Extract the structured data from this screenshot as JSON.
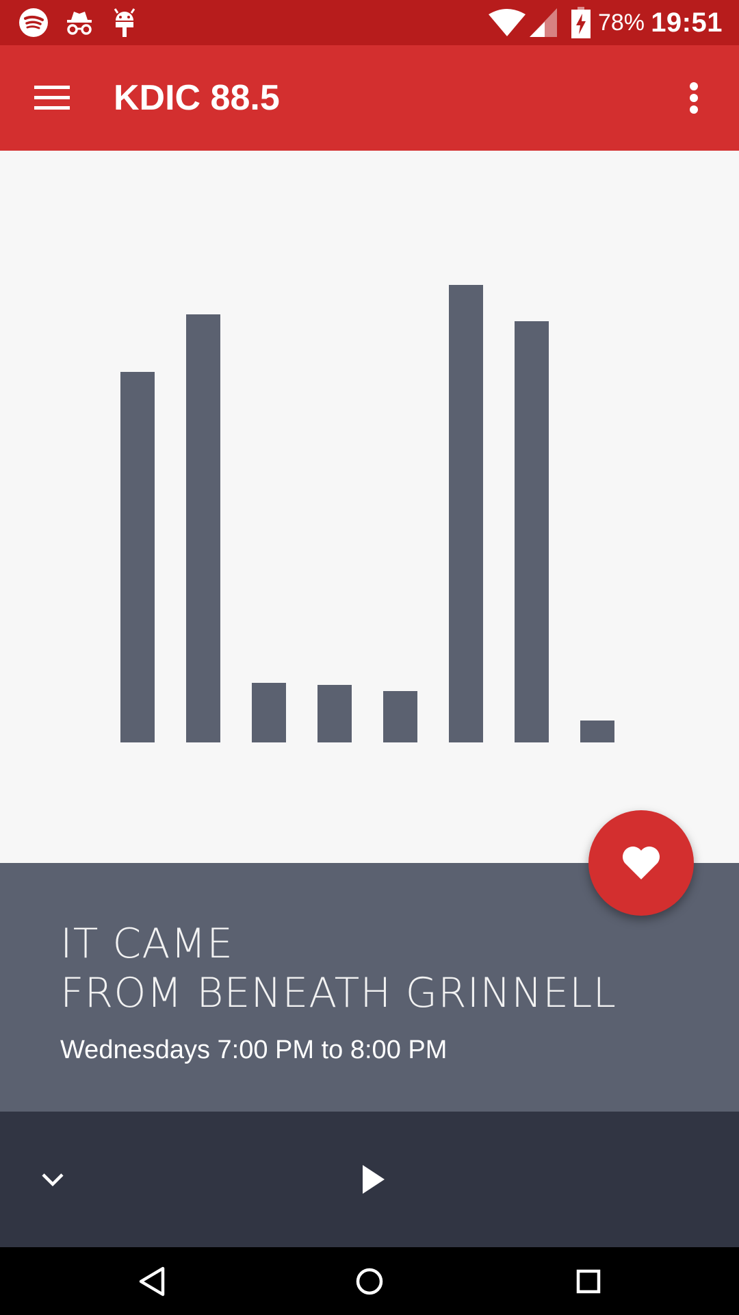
{
  "status_bar": {
    "notification_icons": [
      "spotify-icon",
      "incognito-icon",
      "android-debug-icon"
    ],
    "wifi_icon": "wifi-icon",
    "signal_icon": "cell-signal-icon",
    "battery_icon": "battery-charging-icon",
    "battery_percent": "78%",
    "time": "19:51"
  },
  "app_bar": {
    "menu_icon": "hamburger-menu-icon",
    "title": "KDIC 88.5",
    "overflow_icon": "more-vert-icon"
  },
  "visualizer": {
    "color": "#5b6170",
    "levels": [
      0.81,
      0.935,
      0.13,
      0.125,
      0.112,
      1.0,
      0.92,
      0.048
    ]
  },
  "favorite_button": {
    "icon": "heart-icon"
  },
  "show": {
    "title_line1": "IT CAME",
    "title_line2": "FROM BENEATH GRINNELL",
    "schedule": "Wednesdays 7:00 PM to 8:00 PM"
  },
  "player": {
    "collapse_icon": "chevron-down-icon",
    "play_icon": "play-icon"
  },
  "nav_bar": {
    "back_icon": "back-icon",
    "home_icon": "home-icon",
    "recents_icon": "recents-icon"
  },
  "colors": {
    "status_bar": "#b71c1c",
    "app_bar": "#d32f2f",
    "accent": "#d32f2f",
    "panel": "#5b6170",
    "player": "#313543",
    "background": "#f7f7f7"
  }
}
